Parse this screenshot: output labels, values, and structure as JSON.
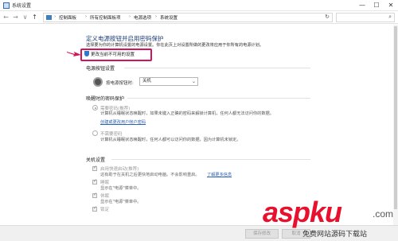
{
  "window": {
    "title": "系统设置",
    "minimize": "—",
    "maximize": "☐",
    "close": "✕"
  },
  "nav": {
    "back": "←",
    "forward": "→",
    "recent": "∨",
    "up": "↑"
  },
  "breadcrumb": [
    "控制面板",
    "所有控制面板项",
    "电源选项",
    "系统设置"
  ],
  "search": {
    "placeholder": ""
  },
  "page": {
    "title": "定义电源按钮并启用密码保护",
    "description": "选择要为你的计算机设置的电源设置。你在此页上对设置所做的更改将应用于你所有的电源计划。",
    "change_link": "更改当前不可用的设置"
  },
  "power_buttons": {
    "header": "电源按钮设置",
    "label": "按电源按钮时:",
    "value": "关机"
  },
  "wake_password": {
    "header": "唤醒时的密码保护",
    "option1": {
      "title": "需要密码(推荐)",
      "text": "计算机从睡眠状态唤醒时，如果未键入正确的密码来解锁计算机，任何人都无法访问你的数据。",
      "link": "创建或更改用户帐户密码"
    },
    "option2": {
      "title": "不需要密码",
      "text": "计算机从睡眠状态唤醒时，任何人都可以访问你的数据，因为计算机未锁定。"
    }
  },
  "shutdown": {
    "header": "关机设置",
    "items": [
      {
        "title": "启用快速启动(推荐)",
        "text": "这有助于在关机之后更快地启动电脑。不会影响重启。",
        "link": "了解更多信息"
      },
      {
        "title": "睡眠",
        "text": "显示在\"电源\"菜单中。"
      },
      {
        "title": "休眠",
        "text": "显示在\"电源\"菜单中。"
      },
      {
        "title": "锁定",
        "text": ""
      }
    ]
  },
  "footer": {
    "save": "保存修改",
    "cancel": "取消"
  },
  "watermark": {
    "logo": "aspku",
    "net": ".com",
    "tagline": "免费网站源码下载站"
  },
  "colors": {
    "highlight": "#d4145a",
    "title_blue": "#1e3d7a",
    "link": "#2b63b3",
    "watermark": "#e8102d"
  }
}
